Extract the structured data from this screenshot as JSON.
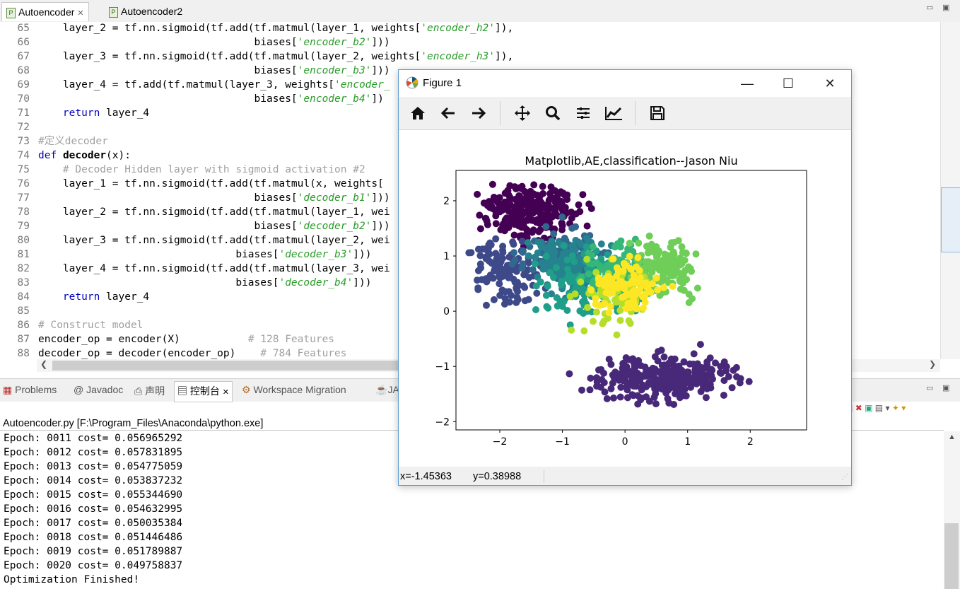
{
  "editor_tabs": [
    {
      "label": "Autoencoder",
      "active": true
    },
    {
      "label": "Autoencoder2",
      "active": false
    }
  ],
  "code_lines": [
    {
      "n": "65",
      "segs": [
        [
          "t",
          "    layer_2 = tf.nn.sigmoid(tf.add(tf.matmul(layer_1, weights["
        ],
        [
          "s",
          "'encoder_h2'"
        ],
        [
          "t",
          "]),"
        ]
      ]
    },
    {
      "n": "66",
      "segs": [
        [
          "t",
          "                                   biases["
        ],
        [
          "s",
          "'encoder_b2'"
        ],
        [
          "t",
          "]))"
        ]
      ]
    },
    {
      "n": "67",
      "segs": [
        [
          "t",
          "    layer_3 = tf.nn.sigmoid(tf.add(tf.matmul(layer_2, weights["
        ],
        [
          "s",
          "'encoder_h3'"
        ],
        [
          "t",
          "]),"
        ]
      ]
    },
    {
      "n": "68",
      "segs": [
        [
          "t",
          "                                   biases["
        ],
        [
          "s",
          "'encoder_b3'"
        ],
        [
          "t",
          "]))"
        ]
      ]
    },
    {
      "n": "69",
      "segs": [
        [
          "t",
          "    layer_4 = tf.add(tf.matmul(layer_3, weights["
        ],
        [
          "s",
          "'encoder_"
        ]
      ]
    },
    {
      "n": "70",
      "segs": [
        [
          "t",
          "                                   biases["
        ],
        [
          "s",
          "'encoder_b4'"
        ],
        [
          "t",
          "])"
        ]
      ]
    },
    {
      "n": "71",
      "segs": [
        [
          "t",
          "    "
        ],
        [
          "k",
          "return"
        ],
        [
          "t",
          " layer_4"
        ]
      ]
    },
    {
      "n": "72",
      "segs": []
    },
    {
      "n": "73",
      "segs": [
        [
          "c",
          "#定义decoder"
        ]
      ]
    },
    {
      "n": "74",
      "segs": [
        [
          "k",
          "def"
        ],
        [
          "t",
          " "
        ],
        [
          "f",
          "decoder"
        ],
        [
          "t",
          "(x):"
        ]
      ]
    },
    {
      "n": "75",
      "segs": [
        [
          "c",
          "    # Decoder Hidden layer with sigmoid activation #2"
        ]
      ]
    },
    {
      "n": "76",
      "segs": [
        [
          "t",
          "    layer_1 = tf.nn.sigmoid(tf.add(tf.matmul(x, weights["
        ]
      ]
    },
    {
      "n": "77",
      "segs": [
        [
          "t",
          "                                   biases["
        ],
        [
          "s",
          "'decoder_b1'"
        ],
        [
          "t",
          "]))"
        ]
      ]
    },
    {
      "n": "78",
      "segs": [
        [
          "t",
          "    layer_2 = tf.nn.sigmoid(tf.add(tf.matmul(layer_1, wei"
        ]
      ]
    },
    {
      "n": "79",
      "segs": [
        [
          "t",
          "                                   biases["
        ],
        [
          "s",
          "'decoder_b2'"
        ],
        [
          "t",
          "]))"
        ]
      ]
    },
    {
      "n": "80",
      "segs": [
        [
          "t",
          "    layer_3 = tf.nn.sigmoid(tf.add(tf.matmul(layer_2, wei"
        ]
      ]
    },
    {
      "n": "81",
      "segs": [
        [
          "t",
          "                                biases["
        ],
        [
          "s",
          "'decoder_b3'"
        ],
        [
          "t",
          "]))"
        ]
      ]
    },
    {
      "n": "82",
      "segs": [
        [
          "t",
          "    layer_4 = tf.nn.sigmoid(tf.add(tf.matmul(layer_3, wei"
        ]
      ]
    },
    {
      "n": "83",
      "segs": [
        [
          "t",
          "                                biases["
        ],
        [
          "s",
          "'decoder_b4'"
        ],
        [
          "t",
          "]))"
        ]
      ]
    },
    {
      "n": "84",
      "segs": [
        [
          "t",
          "    "
        ],
        [
          "k",
          "return"
        ],
        [
          "t",
          " layer_4"
        ]
      ]
    },
    {
      "n": "85",
      "segs": []
    },
    {
      "n": "86",
      "segs": [
        [
          "c",
          "# Construct model"
        ]
      ]
    },
    {
      "n": "87",
      "segs": [
        [
          "t",
          "encoder_op = encoder(X)           "
        ],
        [
          "c",
          "# 128 Features"
        ]
      ]
    },
    {
      "n": "88",
      "segs": [
        [
          "t",
          "decoder_op = decoder(encoder_op)    "
        ],
        [
          "c",
          "# 784 Features"
        ]
      ]
    }
  ],
  "bottom_tabs": [
    {
      "label": "Problems",
      "icon": "problems-icon",
      "active": false
    },
    {
      "label": "Javadoc",
      "icon": "at-icon",
      "active": false
    },
    {
      "label": "声明",
      "icon": "declaration-icon",
      "active": false
    },
    {
      "label": "控制台",
      "icon": "console-icon",
      "active": true
    },
    {
      "label": "Workspace Migration",
      "icon": "migration-icon",
      "active": false
    },
    {
      "label": "JA",
      "icon": "java-icon",
      "active": false
    }
  ],
  "console": {
    "header": "Autoencoder.py [F:\\Program_Files\\Anaconda\\python.exe]",
    "lines": [
      "Epoch: 0011 cost= 0.056965292",
      "Epoch: 0012 cost= 0.057831895",
      "Epoch: 0013 cost= 0.054775059",
      "Epoch: 0014 cost= 0.053837232",
      "Epoch: 0015 cost= 0.055344690",
      "Epoch: 0016 cost= 0.054632995",
      "Epoch: 0017 cost= 0.050035384",
      "Epoch: 0018 cost= 0.051446486",
      "Epoch: 0019 cost= 0.051789887",
      "Epoch: 0020 cost= 0.049758837",
      "Optimization Finished!"
    ]
  },
  "figure": {
    "window_title": "Figure 1",
    "toolbar": [
      "home-icon",
      "back-arrow-icon",
      "forward-arrow-icon",
      "pan-icon",
      "zoom-icon",
      "subplots-icon",
      "edit-axes-icon",
      "save-icon"
    ],
    "status_x": "x=-1.45363",
    "status_y": "y=0.38988"
  },
  "chart_data": {
    "type": "scatter",
    "title": "Matplotlib,AE,classification--Jason Niu",
    "xlim": [
      -2.7,
      2.9
    ],
    "ylim": [
      -2.15,
      2.55
    ],
    "xticks": [
      -2,
      -1,
      0,
      1,
      2
    ],
    "yticks": [
      -2,
      -1,
      0,
      1,
      2
    ],
    "xlabel": "",
    "ylabel": "",
    "grid": false,
    "colormap": "viridis",
    "clusters": [
      {
        "color": "#440154",
        "center": [
          -1.5,
          1.8
        ],
        "spread": [
          0.55,
          0.35
        ],
        "count": 260
      },
      {
        "color": "#482878",
        "center": [
          0.6,
          -1.2
        ],
        "spread": [
          0.9,
          0.35
        ],
        "count": 280
      },
      {
        "color": "#3e4989",
        "center": [
          -1.9,
          0.7
        ],
        "spread": [
          0.4,
          0.5
        ],
        "count": 120
      },
      {
        "color": "#31688e",
        "center": [
          -1.0,
          1.0
        ],
        "spread": [
          0.6,
          0.45
        ],
        "count": 110
      },
      {
        "color": "#26828e",
        "center": [
          -0.9,
          0.9
        ],
        "spread": [
          0.5,
          0.4
        ],
        "count": 120
      },
      {
        "color": "#1f9e89",
        "center": [
          -0.6,
          0.5
        ],
        "spread": [
          0.6,
          0.5
        ],
        "count": 130
      },
      {
        "color": "#35b779",
        "center": [
          -0.1,
          0.7
        ],
        "spread": [
          0.5,
          0.4
        ],
        "count": 110
      },
      {
        "color": "#6ece58",
        "center": [
          0.6,
          0.8
        ],
        "spread": [
          0.4,
          0.4
        ],
        "count": 140
      },
      {
        "color": "#b5de2b",
        "center": [
          -0.2,
          0.3
        ],
        "spread": [
          0.55,
          0.45
        ],
        "count": 70
      },
      {
        "color": "#fde725",
        "center": [
          0.1,
          0.5
        ],
        "spread": [
          0.45,
          0.4
        ],
        "count": 90
      }
    ]
  }
}
